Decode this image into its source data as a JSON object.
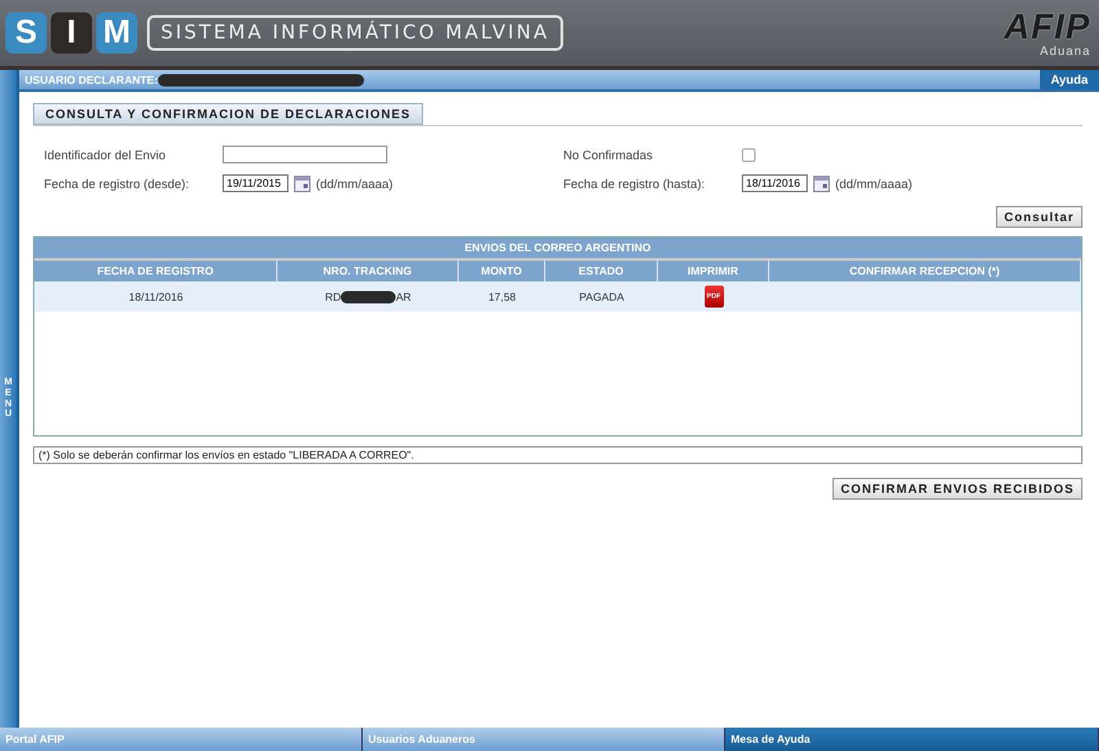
{
  "header": {
    "logo_letters": [
      "S",
      "I",
      "M"
    ],
    "system_name": "SISTEMA INFORMÁTICO MALVINA",
    "agency_logo": "AFIP",
    "agency_sub": "Aduana"
  },
  "user_bar": {
    "label": "USUARIO DECLARANTE:",
    "help": "Ayuda"
  },
  "side_menu": {
    "label": "MENU"
  },
  "section_title": "CONSULTA Y CONFIRMACION DE DECLARACIONES",
  "form": {
    "shipment_id": {
      "label": "Identificador del Envio"
    },
    "unconfirmed": {
      "label": "No Confirmadas",
      "checked": false
    },
    "date_from": {
      "label": "Fecha de registro (desde):",
      "value": "19/11/2015",
      "hint": "(dd/mm/aaaa)"
    },
    "date_to": {
      "label": "Fecha de registro (hasta):",
      "value": "18/11/2016",
      "hint": "(dd/mm/aaaa)"
    },
    "submit": "Consultar"
  },
  "table": {
    "title": "ENVIOS DEL CORREO ARGENTINO",
    "columns": [
      "FECHA DE REGISTRO",
      "NRO. TRACKING",
      "MONTO",
      "ESTADO",
      "IMPRIMIR",
      "CONFIRMAR RECEPCION (*)"
    ],
    "rows": [
      {
        "date": "18/11/2016",
        "tracking_start": "RD",
        "tracking_end": "AR",
        "amount": "17,58",
        "status": "PAGADA",
        "print": "PDF"
      }
    ]
  },
  "note": "(*) Solo se deberán confirmar los envíos en estado \"LIBERADA A CORREO\".",
  "confirm_button": "CONFIRMAR ENVIOS RECIBIDOS",
  "footer": [
    "Portal AFIP",
    "Usuarios Aduaneros",
    "Mesa de Ayuda"
  ]
}
